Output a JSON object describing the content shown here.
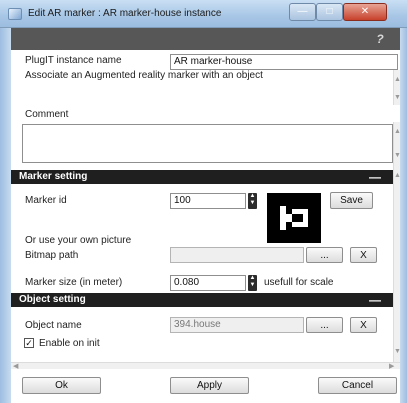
{
  "window": {
    "title": "Edit AR marker : AR marker-house instance"
  },
  "help": {
    "glyph": "?"
  },
  "instance": {
    "label": "PlugIT instance name",
    "value": "AR marker-house",
    "description": "Associate an Augmented reality marker with an object",
    "comment_label": "Comment",
    "comment_value": ""
  },
  "marker_setting": {
    "header": "Marker setting",
    "collapse_glyph": "—",
    "marker_id_label": "Marker id",
    "marker_id_value": "100",
    "save_label": "Save",
    "own_picture_label": "Or use your own picture",
    "bitmap_label": "Bitmap path",
    "bitmap_value": "",
    "browse_label": "...",
    "clear_label": "X",
    "size_label": "Marker size (in meter)",
    "size_value": "0.080",
    "size_hint": "usefull for scale"
  },
  "object_setting": {
    "header": "Object setting",
    "collapse_glyph": "—",
    "object_name_label": "Object name",
    "object_name_value": "394.house",
    "browse_label": "...",
    "clear_label": "X",
    "enable_label": "Enable on init",
    "enable_checked": true
  },
  "footer": {
    "ok_label": "Ok",
    "apply_label": "Apply",
    "cancel_label": "Cancel"
  },
  "icons": {
    "minimize": "minimize-icon",
    "maximize": "maximize-icon",
    "close": "close-icon",
    "help": "help-icon",
    "spin": "spin-updown-icon",
    "checkbox": "checkbox-icon",
    "scroll_up": "scroll-up-icon",
    "scroll_down": "scroll-down-icon",
    "scroll_left": "scroll-left-icon",
    "scroll_right": "scroll-right-icon"
  },
  "colors": {
    "titlebar": "#a7c6e6",
    "section_header": "#1f1f1f",
    "help_strip": "#575757",
    "close_button": "#c7412b"
  }
}
